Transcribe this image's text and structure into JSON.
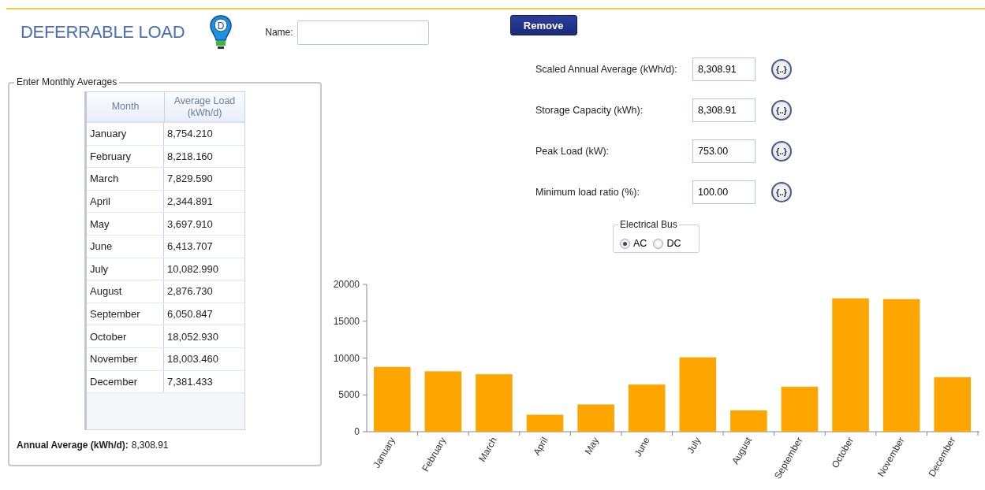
{
  "header": {
    "title": "DEFERRABLE LOAD",
    "logo_letter": "D",
    "name_label": "Name:",
    "remove_button": "Remove"
  },
  "monthly": {
    "legend": "Enter Monthly Averages",
    "columns": [
      "Month",
      "Average Load (kWh/d)"
    ],
    "rows": [
      {
        "month": "January",
        "value": "8,754.210"
      },
      {
        "month": "February",
        "value": "8,218.160"
      },
      {
        "month": "March",
        "value": "7,829.590"
      },
      {
        "month": "April",
        "value": "2,344.891"
      },
      {
        "month": "May",
        "value": "3,697.910"
      },
      {
        "month": "June",
        "value": "6,413.707"
      },
      {
        "month": "July",
        "value": "10,082.990"
      },
      {
        "month": "August",
        "value": "2,876.730"
      },
      {
        "month": "September",
        "value": "6,050.847"
      },
      {
        "month": "October",
        "value": "18,052.930"
      },
      {
        "month": "November",
        "value": "18,003.460"
      },
      {
        "month": "December",
        "value": "7,381.433"
      }
    ],
    "annual_label": "Annual Average (kWh/d):",
    "annual_value": "8,308.91"
  },
  "fields": [
    {
      "label": "Scaled Annual Average (kWh/d):",
      "value": "8,308.91",
      "button": "{..}"
    },
    {
      "label": "Storage Capacity (kWh):",
      "value": "8,308.91",
      "button": "{..}"
    },
    {
      "label": "Peak Load (kW):",
      "value": "753.00",
      "button": "{..}"
    },
    {
      "label": "Minimum load ratio (%):",
      "value": "100.00",
      "button": "{..}"
    }
  ],
  "electrical_bus": {
    "legend": "Electrical Bus",
    "options": [
      {
        "label": "AC",
        "selected": true
      },
      {
        "label": "DC",
        "selected": false
      }
    ]
  },
  "chart": {
    "chart_data": {
      "type": "bar",
      "categories": [
        "January",
        "February",
        "March",
        "April",
        "May",
        "June",
        "July",
        "August",
        "September",
        "October",
        "November",
        "December"
      ],
      "series": [
        {
          "color": "#ffa500",
          "values": [
            8800,
            8200,
            7800,
            2300,
            3700,
            6400,
            10100,
            2900,
            6100,
            18100,
            18000,
            7400
          ]
        }
      ],
      "ylim": [
        0,
        20000
      ],
      "yticks": [
        0,
        5000,
        10000,
        15000,
        20000
      ]
    }
  }
}
